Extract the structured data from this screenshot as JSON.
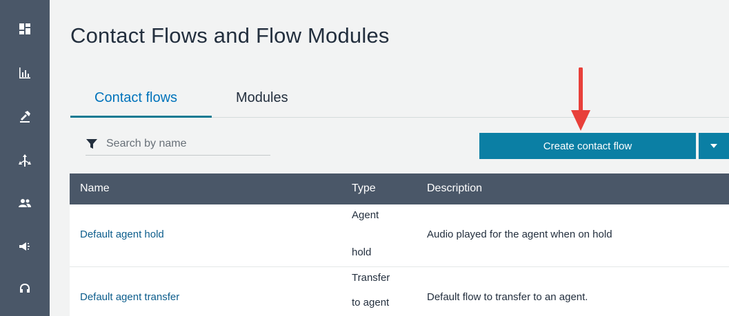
{
  "nav_rail": {
    "icons": [
      "dashboard-icon",
      "metrics-icon",
      "routing-icon",
      "flows-icon",
      "users-icon",
      "campaigns-icon",
      "headset-icon"
    ]
  },
  "page": {
    "title": "Contact Flows and Flow Modules"
  },
  "tabs": [
    {
      "label": "Contact flows",
      "active": true
    },
    {
      "label": "Modules",
      "active": false
    }
  ],
  "search": {
    "placeholder": "Search by name",
    "value": ""
  },
  "actions": {
    "create_label": "Create contact flow"
  },
  "table": {
    "columns": [
      "Name",
      "Type",
      "Description"
    ],
    "rows": [
      {
        "name": "Default agent hold",
        "type_lines": [
          "Agent",
          "hold"
        ],
        "description": "Audio played for the agent when on hold"
      },
      {
        "name": "Default agent transfer",
        "type_lines": [
          "Transfer",
          "to agent"
        ],
        "description": "Default flow to transfer to an agent."
      }
    ]
  },
  "colors": {
    "rail": "#4a5768",
    "accent": "#0b7fa4",
    "link": "#0c5d8c",
    "annotation": "#e8403a"
  }
}
